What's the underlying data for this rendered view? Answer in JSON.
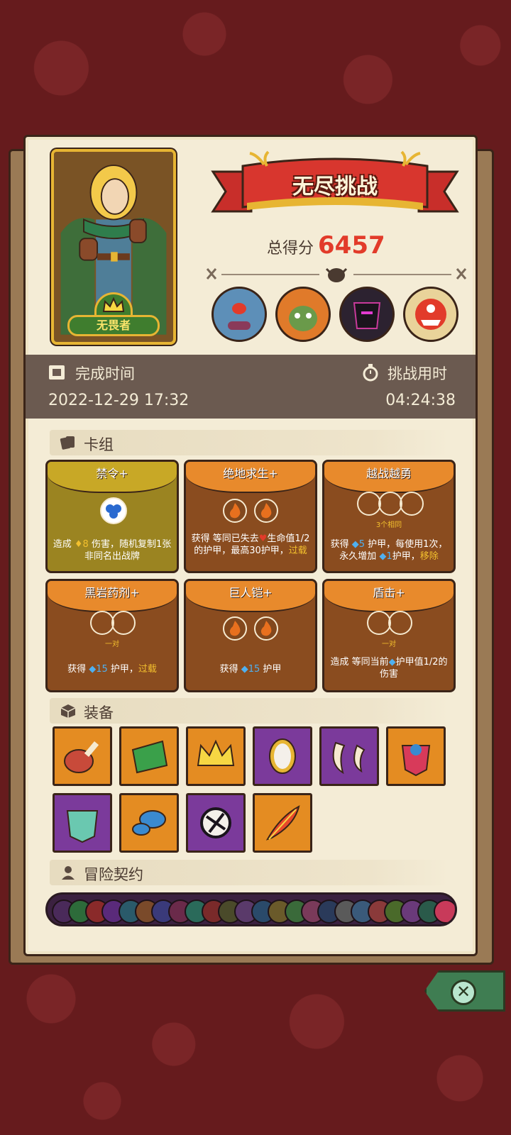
{
  "banner": {
    "title": "无尽挑战"
  },
  "score": {
    "label": "总得分",
    "value": "6457"
  },
  "hero": {
    "name": "无畏者"
  },
  "bosses": [
    {
      "icon": "blue-cyclops-boss-icon",
      "color": "#5d8fb8"
    },
    {
      "icon": "orange-goblin-boss-icon",
      "color": "#e07a2a"
    },
    {
      "icon": "dark-knight-boss-icon",
      "color": "#2c2230"
    },
    {
      "icon": "flame-mask-boss-icon",
      "color": "#e9d39a"
    }
  ],
  "times": {
    "finish_label": "完成时间",
    "finish_value": "2022-12-29 17:32",
    "duration_label": "挑战用时",
    "duration_value": "04:24:38"
  },
  "sections": {
    "deck": "卡组",
    "equipment": "装备",
    "contracts": "冒险契约"
  },
  "cards": [
    {
      "title": "禁令+",
      "style": "gold",
      "desc_parts": [
        "造成 ",
        "♦8",
        " 伤害，随机复制1张非同名出战牌"
      ],
      "sub": ""
    },
    {
      "title": "绝地求生+",
      "style": "orange",
      "desc_parts": [
        "获得 等同已失去",
        "♥",
        "生命值1/2 的护甲，最高30护甲，",
        "过载"
      ],
      "sub": ""
    },
    {
      "title": "越战越勇",
      "style": "orange",
      "desc_parts": [
        "获得 ",
        "◆5",
        " 护甲，每使用1次，永久增加 ",
        "◆1",
        "护甲，",
        "移除"
      ],
      "sub": "3个相同"
    },
    {
      "title": "黑岩药剂+",
      "style": "orange",
      "desc_parts": [
        "获得 ",
        "◆15",
        " 护甲，",
        "过载"
      ],
      "sub": "一对"
    },
    {
      "title": "巨人铠+",
      "style": "orange",
      "desc_parts": [
        "获得 ",
        "◆15",
        " 护甲"
      ],
      "sub": ""
    },
    {
      "title": "盾击+",
      "style": "orange",
      "desc_parts": [
        "造成 等同当前",
        "◆",
        "护甲值1/2的伤害"
      ],
      "sub": "一对"
    }
  ],
  "equipment": [
    {
      "icon": "meat-leg-icon",
      "bg": "orange"
    },
    {
      "icon": "mossy-stone-icon",
      "bg": "orange"
    },
    {
      "icon": "golden-crown-icon",
      "bg": "orange"
    },
    {
      "icon": "magic-mirror-icon",
      "bg": "purple"
    },
    {
      "icon": "claws-icon",
      "bg": "purple"
    },
    {
      "icon": "tribal-mask-icon",
      "bg": "orange"
    },
    {
      "icon": "jade-demon-mask-icon",
      "bg": "purple"
    },
    {
      "icon": "blue-mushroom-icon",
      "bg": "orange"
    },
    {
      "icon": "cracked-orb-icon",
      "bg": "purple"
    },
    {
      "icon": "phoenix-feather-icon",
      "bg": "orange"
    }
  ],
  "contract_colors": [
    "#4a2a5a",
    "#2d6b3a",
    "#8a2a2a",
    "#5a2a7a",
    "#2a5a6a",
    "#7a4a2a",
    "#3a3a7a",
    "#6a2a4a",
    "#2a6a5a",
    "#7a2a2a",
    "#4a4a2a",
    "#5a3a6a",
    "#2a4a6a",
    "#6a5a2a",
    "#3a6a3a",
    "#7a3a5a",
    "#2a3a5a",
    "#5a5a5a",
    "#3a5a7a",
    "#8a3a3a",
    "#4a6a2a",
    "#6a3a7a",
    "#2a5a4a",
    "#c83a5a"
  ]
}
